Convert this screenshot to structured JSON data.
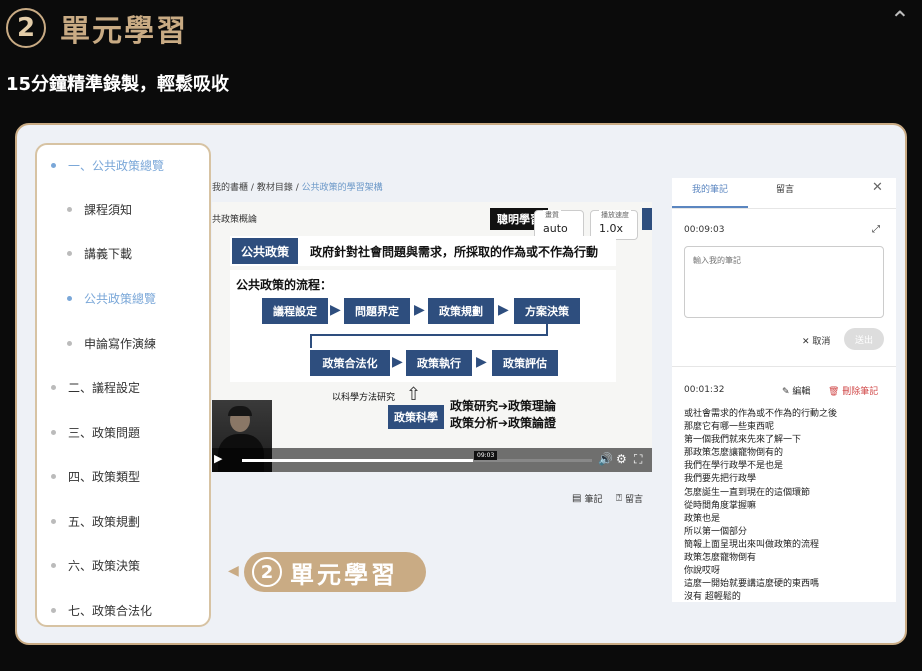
{
  "header": {
    "number": "2",
    "title": "單元學習",
    "subtitle": "15分鐘精準錄製，輕鬆吸收"
  },
  "sidebar": {
    "items": [
      {
        "label": "一、公共政策總覽",
        "active": true
      },
      {
        "label": "課程須知"
      },
      {
        "label": "講義下載"
      },
      {
        "label": "公共政策總覽",
        "active": true
      },
      {
        "label": "申論寫作演練"
      },
      {
        "label": "二、議程設定"
      },
      {
        "label": "三、政策問題"
      },
      {
        "label": "四、政策類型"
      },
      {
        "label": "五、政策規劃"
      },
      {
        "label": "六、政策決策"
      },
      {
        "label": "七、政策合法化"
      }
    ]
  },
  "breadcrumb": {
    "item1": "我的書櫃",
    "sep": "/",
    "item2": "教材目錄",
    "current": "公共政策的學習架構"
  },
  "video": {
    "slide_heading": "共政策概論",
    "brand": "聰明學習",
    "quality": {
      "label": "畫質",
      "value": "auto"
    },
    "speed": {
      "label": "播放速度",
      "value": "1.0x"
    },
    "definition": {
      "term": "公共政策",
      "text": "政府針對社會問題與需求，所採取的作為或不作為行動"
    },
    "flow": {
      "title": "公共政策的流程：",
      "row1": [
        "議程設定",
        "問題界定",
        "政策規劃",
        "方案決策"
      ],
      "row2": [
        "政策合法化",
        "政策執行",
        "政策評估"
      ]
    },
    "research": {
      "label": "以科學方法研究",
      "box": "政策科學",
      "line1": "政策研究➔政策理論",
      "line2": "政策分析➔政策論證"
    },
    "controls": {
      "current_time": "09:03",
      "progress": 0.66
    }
  },
  "video_actions": {
    "notes": "筆記",
    "comments": "留言"
  },
  "panel": {
    "tabs": {
      "notes": "我的筆記",
      "comments": "留言"
    },
    "current_time": "00:09:03",
    "note_placeholder": "輸入我的筆記",
    "cancel": "取消",
    "submit": "送出",
    "saved_note": {
      "time": "00:01:32",
      "edit": "編輯",
      "delete": "刪除筆記",
      "lines": [
        "或社會需求的作為或不作為的行動之後",
        "那麼它有哪一些東西呢",
        "第一個我們就來先來了解一下",
        "那政策怎麼讓寵物倒有的",
        "我們在學行政學不是也是",
        "我們要先把行政學",
        "怎麼誕生一直到現在的這個環節",
        "從時間角度掌握嘛",
        "政策也是",
        "所以第一個部分",
        "簡報上面呈現出來叫做政策的流程",
        "政策怎麼寵物倒有",
        "你說哎呀",
        "這麼一開始就要講這麼硬的東西嗎",
        "沒有 超輕鬆的"
      ]
    }
  },
  "promo": {
    "number": "2",
    "text": "單元學習"
  },
  "colors": {
    "gold": "#c9ab84",
    "navy": "#2e4e7e",
    "link_blue": "#5b86c0",
    "delete_red": "#d04848"
  }
}
